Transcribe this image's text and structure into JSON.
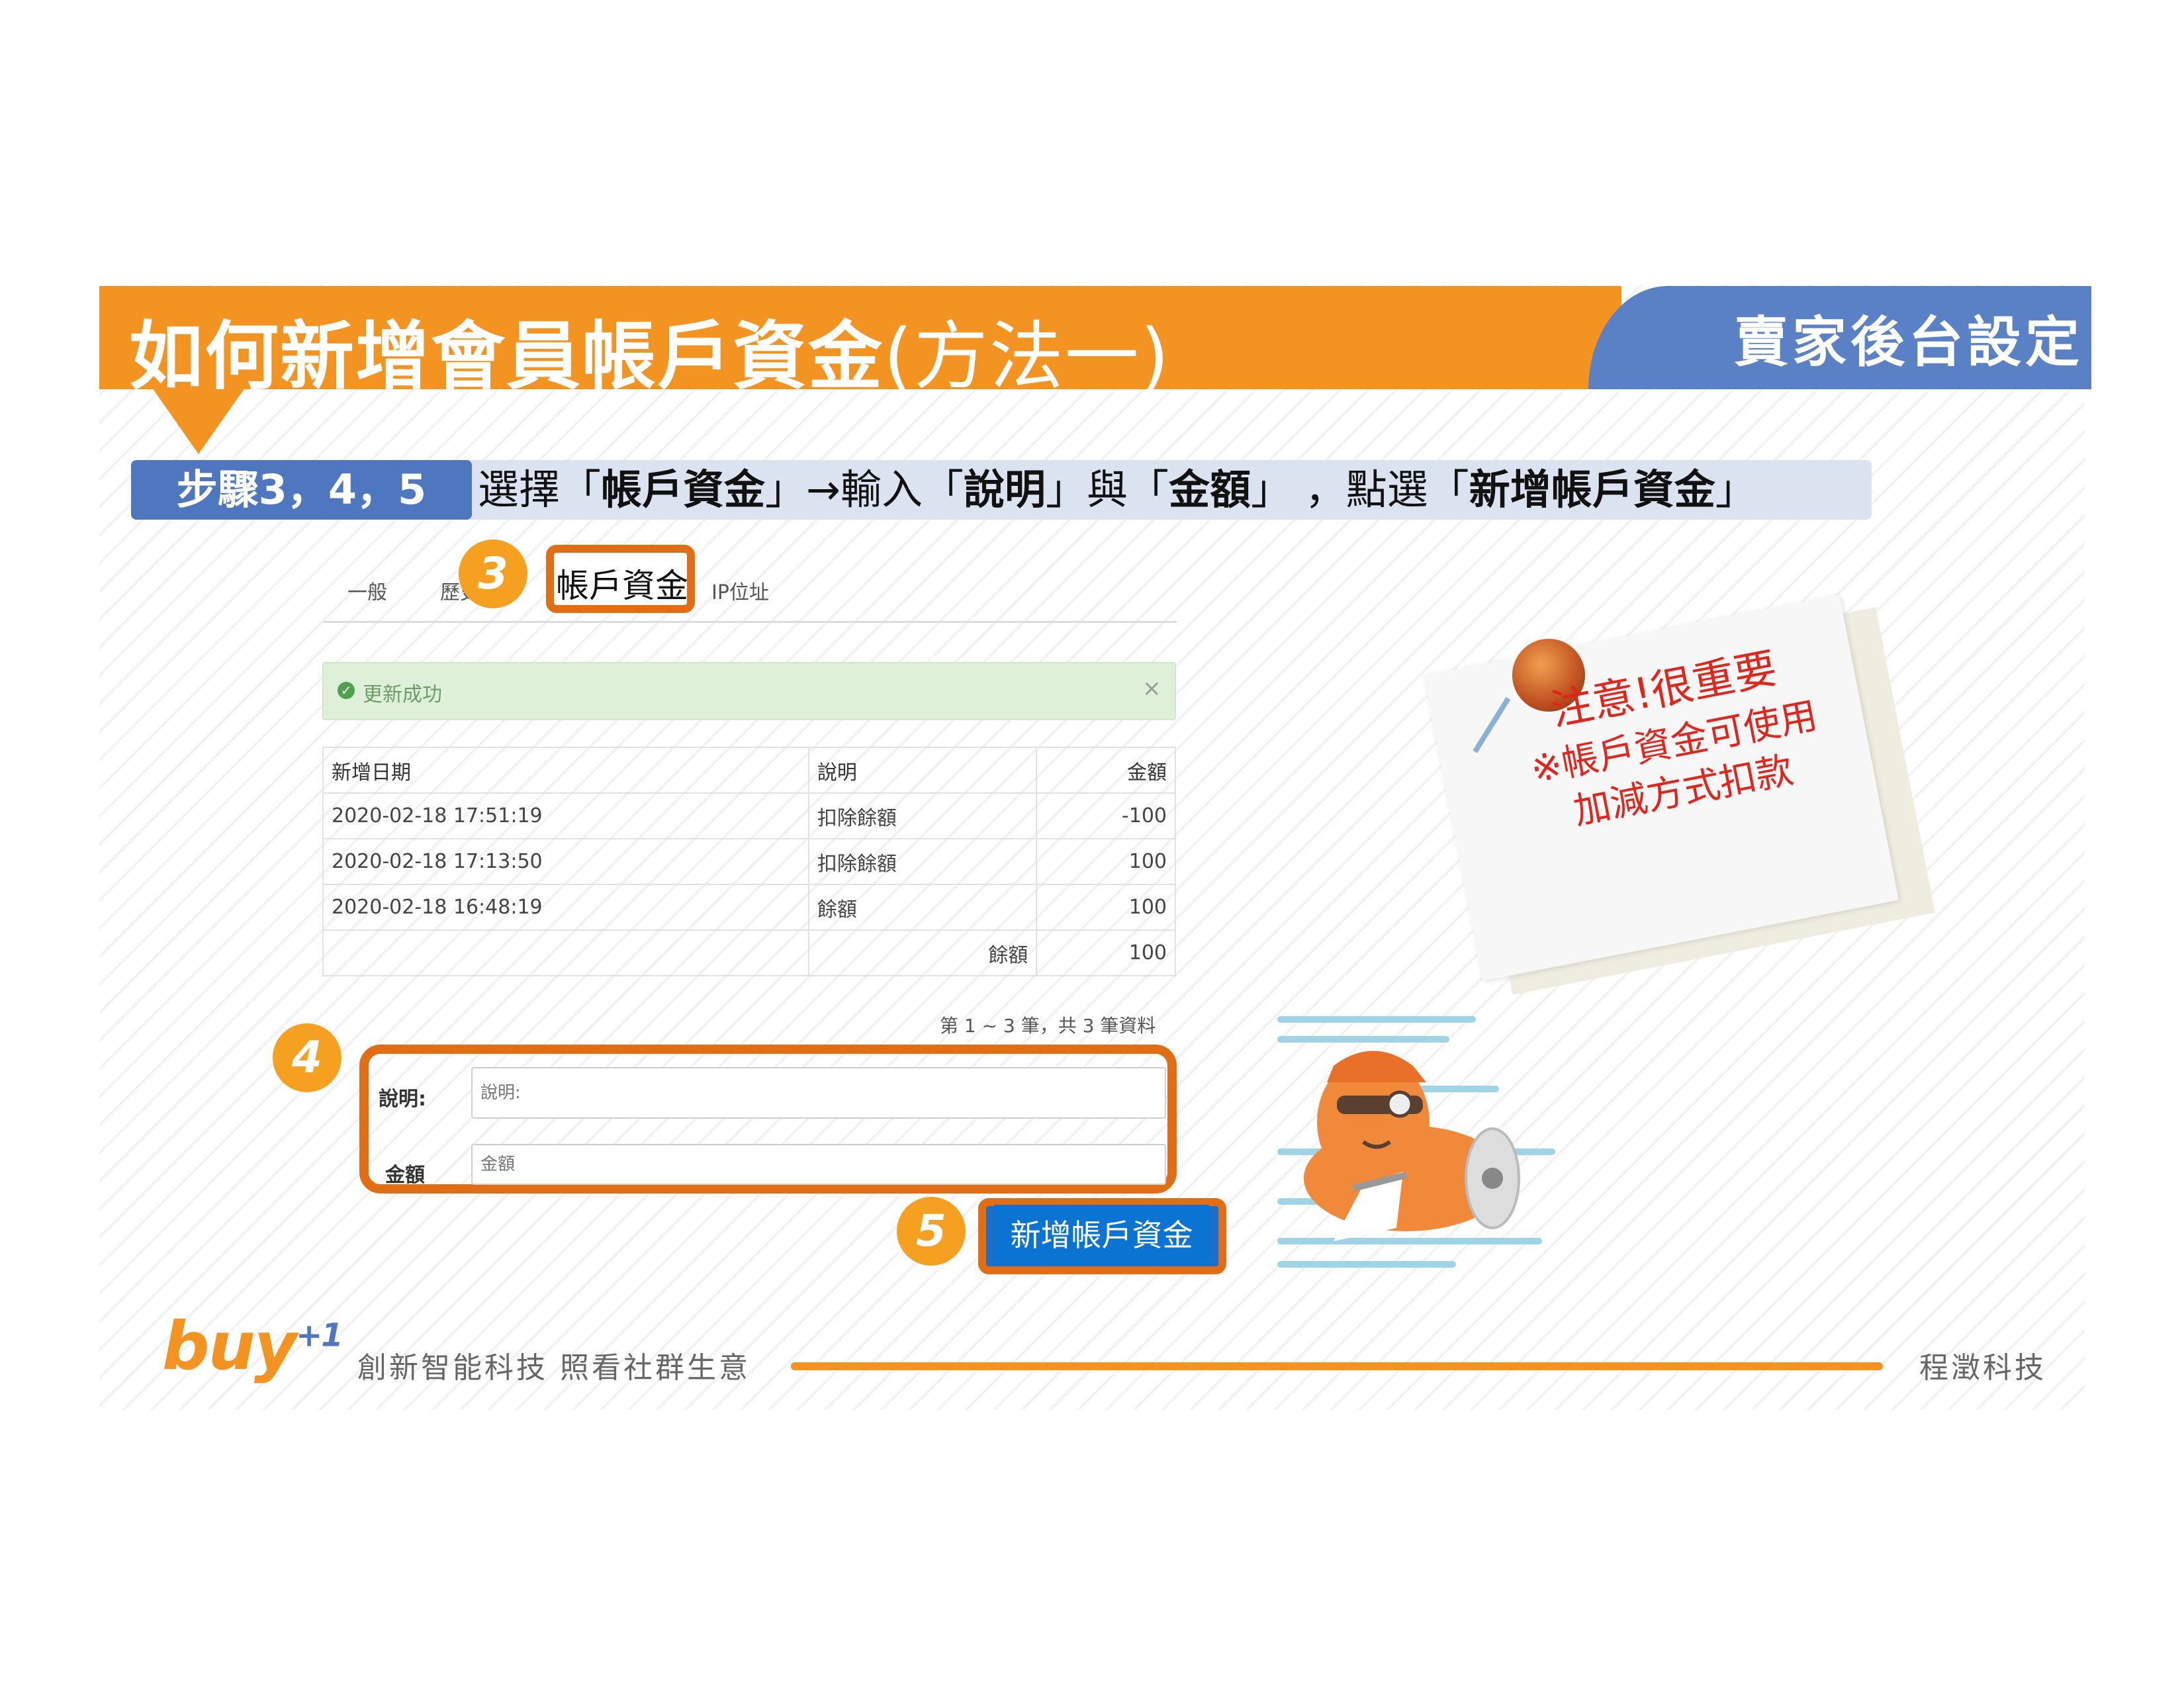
{
  "header": {
    "title_bold": "如何新增會員帳戶資金",
    "title_light": "(方法一)",
    "section": "賣家後台設定"
  },
  "step": {
    "badge": "步驟3，4，5",
    "text_parts": [
      "選擇「",
      "帳戶資金",
      "」→輸入「",
      "說明",
      "」與「",
      "金額",
      "」 ，點選「",
      "新增帳戶資金",
      "」"
    ]
  },
  "tabs": {
    "general": "一般",
    "history": "歷史",
    "account_funds": "帳戶資金",
    "ip": "IP位址"
  },
  "markers": {
    "m3": "3",
    "m4": "4",
    "m5": "5"
  },
  "alert": {
    "text": "更新成功",
    "close": "×",
    "icon": "check-icon"
  },
  "table": {
    "headers": [
      "新增日期",
      "說明",
      "金額"
    ],
    "rows": [
      [
        "2020-02-18 17:51:19",
        "扣除餘額",
        "-100"
      ],
      [
        "2020-02-18 17:13:50",
        "扣除餘額",
        "100"
      ],
      [
        "2020-02-18 16:48:19",
        "餘額",
        "100"
      ]
    ],
    "balance_label": "餘額",
    "balance_value": "100"
  },
  "pager": "第 1 ~ 3 筆，共 3 筆資料",
  "form": {
    "desc_label": "說明:",
    "desc_placeholder": "說明:",
    "amount_label": "金額",
    "amount_placeholder": "金額",
    "submit": "新增帳戶資金"
  },
  "note": {
    "title": "注意!很重要",
    "line1": "※帳戶資金可使用",
    "line2": "加減方式扣款"
  },
  "footer": {
    "logo": "buy",
    "logo_sup": "+1",
    "slogan": "創新智能科技 照看社群生意",
    "company": "程澂科技"
  },
  "colors": {
    "orange": "#f29322",
    "blue": "#5a81c6",
    "highlight": "#e16d14",
    "button": "#0b73d1",
    "note_text": "#e3241b"
  }
}
